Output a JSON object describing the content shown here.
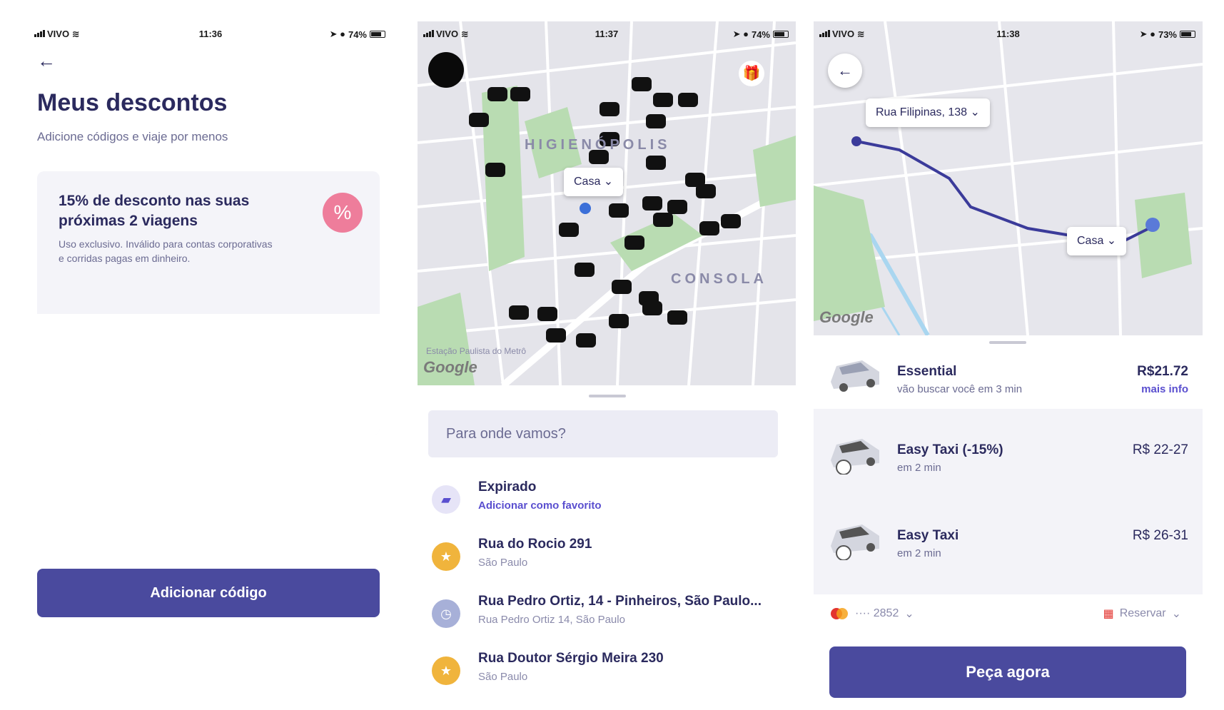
{
  "colors": {
    "primary": "#4a4a9e",
    "pink": "#ee7d9b",
    "gold": "#f0b43c",
    "text": "#2b2a5e",
    "route": "#3b3b9a"
  },
  "screen1": {
    "status": {
      "carrier": "VIVO",
      "time": "11:36",
      "battery": "74%"
    },
    "back_icon": "arrow-left-icon",
    "title": "Meus descontos",
    "subtitle": "Adicione códigos e viaje por menos",
    "discount": {
      "title": "15% de desconto nas suas próximas 2 viagens",
      "description": "Uso exclusivo. Inválido para contas corporativas e corridas pagas em dinheiro.",
      "badge": "%"
    },
    "add_button": "Adicionar código"
  },
  "screen2": {
    "status": {
      "carrier": "VIVO",
      "time": "11:37",
      "battery": "74%"
    },
    "map": {
      "district1": "HIGIENÓPOLIS",
      "district2": "CONSOLA",
      "station": "Estação Paulista do Metrô",
      "pin_label": "Casa",
      "google": "Google"
    },
    "search_placeholder": "Para onde vamos?",
    "places": [
      {
        "name": "Expirado",
        "sub": "Adicionar como favorito",
        "icon": "briefcase-icon"
      },
      {
        "name": "Rua do Rocio 291",
        "sub": "São Paulo",
        "icon": "star-icon"
      },
      {
        "name": "Rua Pedro Ortiz, 14 - Pinheiros, São Paulo...",
        "sub": "Rua Pedro Ortiz 14, São Paulo",
        "icon": "clock-icon"
      },
      {
        "name": "Rua Doutor Sérgio Meira 230",
        "sub": "São Paulo",
        "icon": "star-icon"
      }
    ]
  },
  "screen3": {
    "status": {
      "carrier": "VIVO",
      "time": "11:38",
      "battery": "73%"
    },
    "map": {
      "origin": "Rua Filipinas, 138",
      "destination": "Casa",
      "google": "Google"
    },
    "rides": [
      {
        "name": "Essential",
        "eta": "vão buscar você em 3 min",
        "price": "R$21.72",
        "more": "mais info"
      },
      {
        "name": "Easy Taxi (-15%)",
        "eta": "em 2 min",
        "price": "R$ 22-27"
      },
      {
        "name": "Easy Taxi",
        "eta": "em 2 min",
        "price": "R$ 26-31"
      }
    ],
    "payment": "···· 2852",
    "reserve": "Reservar",
    "order_button": "Peça agora"
  }
}
